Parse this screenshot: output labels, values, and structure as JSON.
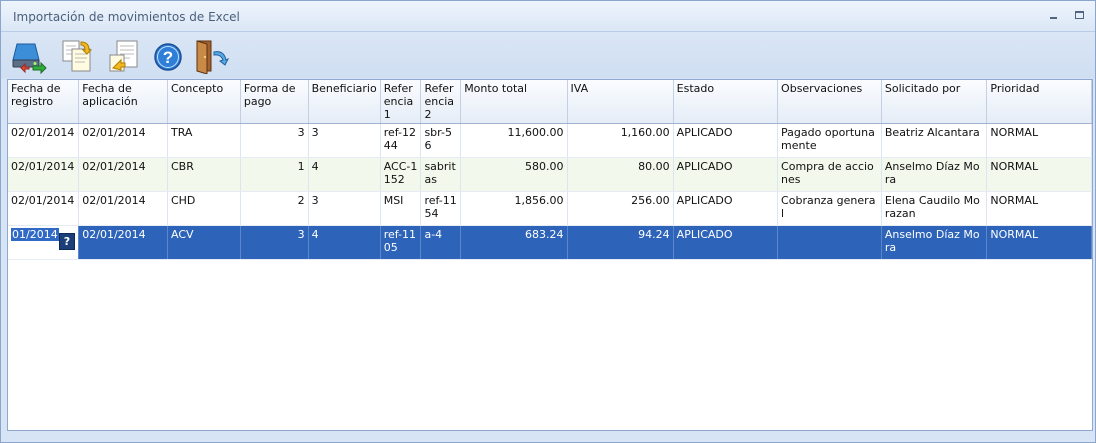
{
  "window": {
    "title": "Importación de movimientos de Excel"
  },
  "toolbar": {
    "buttons": [
      {
        "name": "import-disk-icon"
      },
      {
        "name": "copy-documents-icon"
      },
      {
        "name": "export-document-icon"
      },
      {
        "name": "help-icon"
      },
      {
        "name": "exit-door-icon"
      }
    ]
  },
  "grid": {
    "columns": [
      "Fecha de registro",
      "Fecha de aplicación",
      "Concepto",
      "Forma de pago",
      "Beneficiario",
      "Referencia1",
      "Referencia2",
      "Monto total",
      "IVA",
      "Estado",
      "Observaciones",
      "Solicitado por",
      "Prioridad"
    ],
    "rows": [
      [
        "02/01/2014",
        "02/01/2014",
        "TRA",
        "3",
        "3",
        "ref-1244",
        "sbr-56",
        "11,600.00",
        "1,160.00",
        "APLICADO",
        "Pagado oportunamente",
        "Beatriz Alcantara",
        "NORMAL"
      ],
      [
        "02/01/2014",
        "02/01/2014",
        "CBR",
        "1",
        "4",
        "ACC-1152",
        "sabritas",
        "580.00",
        "80.00",
        "APLICADO",
        "Compra de acciones",
        "Anselmo Díaz Mora",
        "NORMAL"
      ],
      [
        "02/01/2014",
        "02/01/2014",
        "CHD",
        "2",
        "3",
        "MSI",
        "ref-1154",
        "1,856.00",
        "256.00",
        "APLICADO",
        "Cobranza general",
        "Elena Caudilo Morazan",
        "NORMAL"
      ],
      [
        "01/2014",
        "02/01/2014",
        "ACV",
        "3",
        "4",
        "ref-1105",
        "a-4",
        "683.24",
        "94.24",
        "APLICADO",
        "",
        "Anselmo Díaz Mora",
        "NORMAL"
      ]
    ],
    "selected_row": 3,
    "editor_help_glyph": "?"
  },
  "colors": {
    "selection": "#2d63b8",
    "alt_row": "#f3f8ec",
    "chrome": "#d6e4f5"
  }
}
